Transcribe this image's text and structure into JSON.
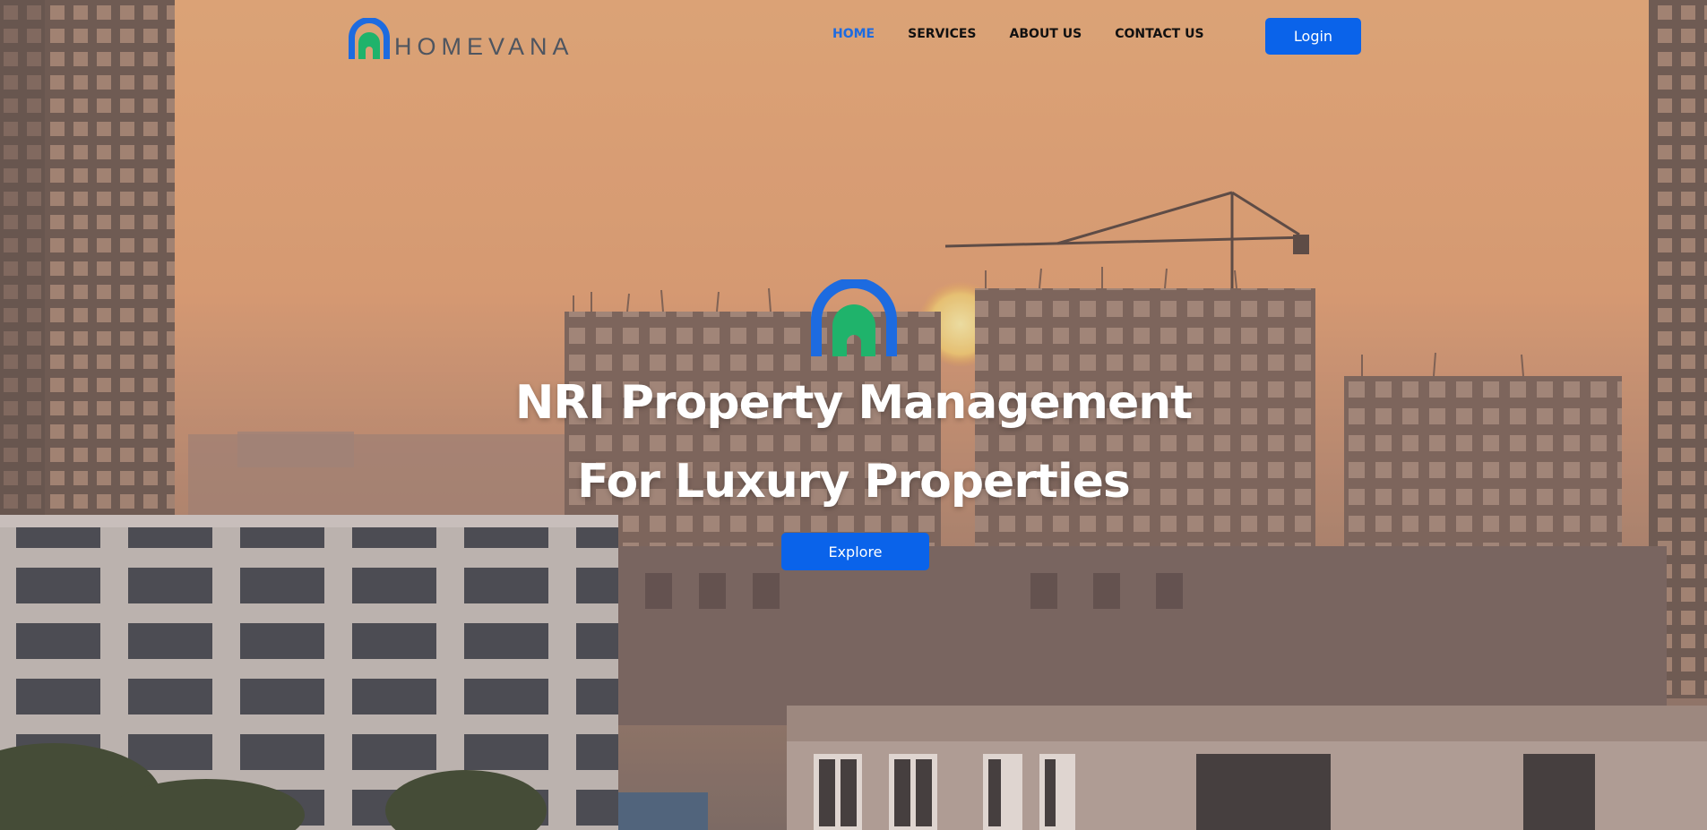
{
  "brand": {
    "name": "HOMEVANA",
    "icon": "arch-house-icon",
    "colors": {
      "arch": "#1d6be0",
      "house": "#1fb36b"
    }
  },
  "nav": {
    "items": [
      {
        "label": "HOME",
        "active": true
      },
      {
        "label": "SERVICES",
        "active": false
      },
      {
        "label": "ABOUT US",
        "active": false
      },
      {
        "label": "CONTACT US",
        "active": false
      }
    ],
    "login_label": "Login"
  },
  "hero": {
    "title_line1": "NRI Property Management",
    "title_line2": "For Luxury Properties",
    "cta_label": "Explore",
    "background": "city-construction-sunset-photo"
  },
  "colors": {
    "accent": "#0a63ea",
    "active_nav": "#1d6be0",
    "nav_text": "#111111",
    "hero_text": "#ffffff"
  }
}
